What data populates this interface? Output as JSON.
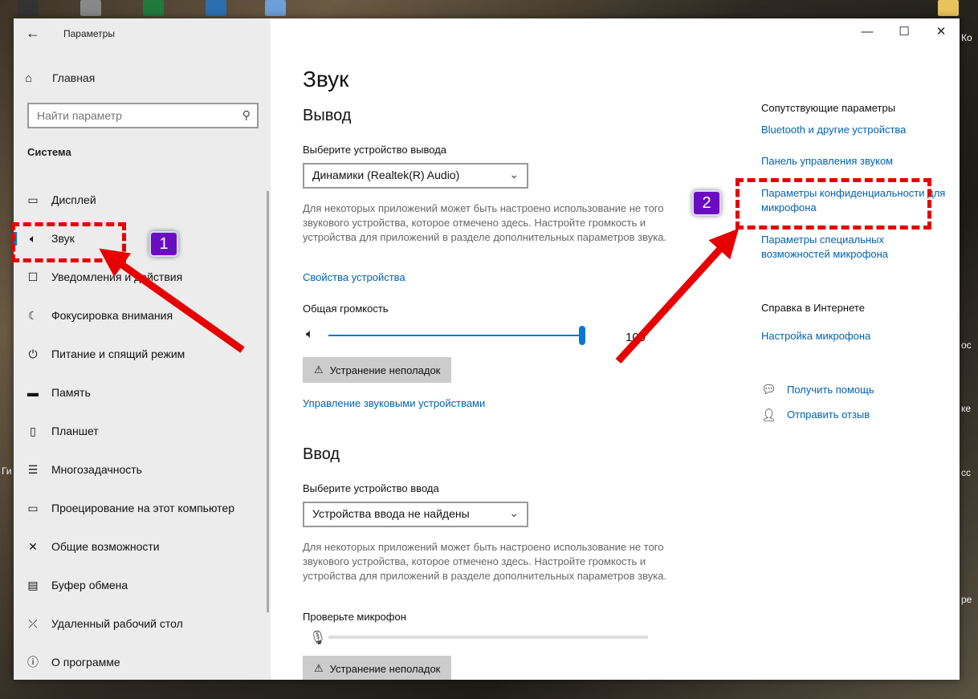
{
  "desktop": {
    "right_edge_texts": [
      "Ко",
      "ос",
      "ке",
      "сс",
      "ре"
    ],
    "left_edge_texts": [
      "Ги"
    ]
  },
  "window": {
    "title": "Параметры",
    "back_icon": "arrow-left-icon",
    "controls": {
      "minimize": "—",
      "maximize": "☐",
      "close": "✕"
    }
  },
  "sidebar": {
    "home_label": "Главная",
    "search_placeholder": "Найти параметр",
    "section": "Система",
    "items": [
      {
        "label": "Дисплей",
        "icon": "display-icon",
        "glyph": "▭"
      },
      {
        "label": "Звук",
        "icon": "speaker-icon",
        "glyph": "🔈"
      },
      {
        "label": "Уведомления и действия",
        "icon": "notification-icon",
        "glyph": "☐"
      },
      {
        "label": "Фокусировка внимания",
        "icon": "moon-icon",
        "glyph": "☾"
      },
      {
        "label": "Питание и спящий режим",
        "icon": "power-icon",
        "glyph": "⏻"
      },
      {
        "label": "Память",
        "icon": "storage-icon",
        "glyph": "▬"
      },
      {
        "label": "Планшет",
        "icon": "tablet-icon",
        "glyph": "▯"
      },
      {
        "label": "Многозадачность",
        "icon": "multitask-icon",
        "glyph": "☰"
      },
      {
        "label": "Проецирование на этот компьютер",
        "icon": "project-icon",
        "glyph": "▭"
      },
      {
        "label": "Общие возможности",
        "icon": "shared-icon",
        "glyph": "✕"
      },
      {
        "label": "Буфер обмена",
        "icon": "clipboard-icon",
        "glyph": "📋"
      },
      {
        "label": "Удаленный рабочий стол",
        "icon": "remote-icon",
        "glyph": "✕"
      },
      {
        "label": "О программе",
        "icon": "info-icon",
        "glyph": "ⓘ"
      }
    ]
  },
  "main": {
    "title": "Звук",
    "output": {
      "heading": "Вывод",
      "device_label": "Выберите устройство вывода",
      "device_value": "Динамики (Realtek(R) Audio)",
      "help": "Для некоторых приложений может быть настроено использование не того звукового устройства, которое отмечено здесь. Настройте громкость и устройства для приложений в разделе дополнительных параметров звука.",
      "device_props_link": "Свойства устройства",
      "volume_label": "Общая громкость",
      "volume_value": "100",
      "volume_fraction": 1.0,
      "troubleshoot": "Устранение неполадок",
      "manage_link": "Управление звуковыми устройствами"
    },
    "input": {
      "heading": "Ввод",
      "device_label": "Выберите устройство ввода",
      "device_value": "Устройства ввода не найдены",
      "help": "Для некоторых приложений может быть настроено использование не того звукового устройства, которое отмечено здесь. Настройте громкость и устройства для приложений в разделе дополнительных параметров звука.",
      "test_label": "Проверьте микрофон",
      "troubleshoot": "Устранение неполадок"
    }
  },
  "related": {
    "title": "Сопутствующие параметры",
    "links": [
      "Bluetooth и другие устройства",
      "Панель управления звуком",
      "Параметры конфиденциальности для микрофона",
      "Параметры специальных возможностей микрофона"
    ],
    "web_help_title": "Справка в Интернете",
    "web_help_link": "Настройка микрофона",
    "get_help": "Получить помощь",
    "feedback": "Отправить отзыв"
  },
  "annotations": {
    "badge1": "1",
    "badge2": "2",
    "color": "#e60000",
    "badge_color": "#6a0dc0"
  }
}
